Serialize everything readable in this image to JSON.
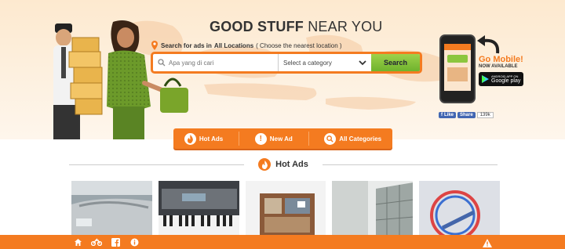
{
  "header": {
    "headline_bold": "GOOD STUFF",
    "headline_rest": "NEAR YOU",
    "location_prefix": "Search for ads in",
    "location_name": "All Locations",
    "location_hint": "( Choose the nearest location )"
  },
  "search": {
    "placeholder": "Apa yang di cari",
    "category_value": "Select a category",
    "button_label": "Search"
  },
  "nav_tabs": [
    {
      "label": "Hot Ads",
      "icon": "flame-icon"
    },
    {
      "label": "New Ad",
      "icon": "exclamation-icon"
    },
    {
      "label": "All Categories",
      "icon": "search-icon"
    }
  ],
  "mobile": {
    "title": "Go Mobile!",
    "subtitle": "NOW AVAILABLE",
    "store_small": "ANDROID APP ON",
    "store_name": "Google play"
  },
  "facebook": {
    "like_label": "Like",
    "share_label": "Share",
    "count": "139k"
  },
  "section": {
    "title": "Hot Ads"
  },
  "footer": {
    "icons": [
      "home-icon",
      "motorbike-icon",
      "facebook-icon",
      "info-icon"
    ],
    "warning_icon": "warning-icon"
  },
  "colors": {
    "accent": "#f47b20",
    "search_button": "#8cc63f",
    "facebook": "#4267b2"
  }
}
